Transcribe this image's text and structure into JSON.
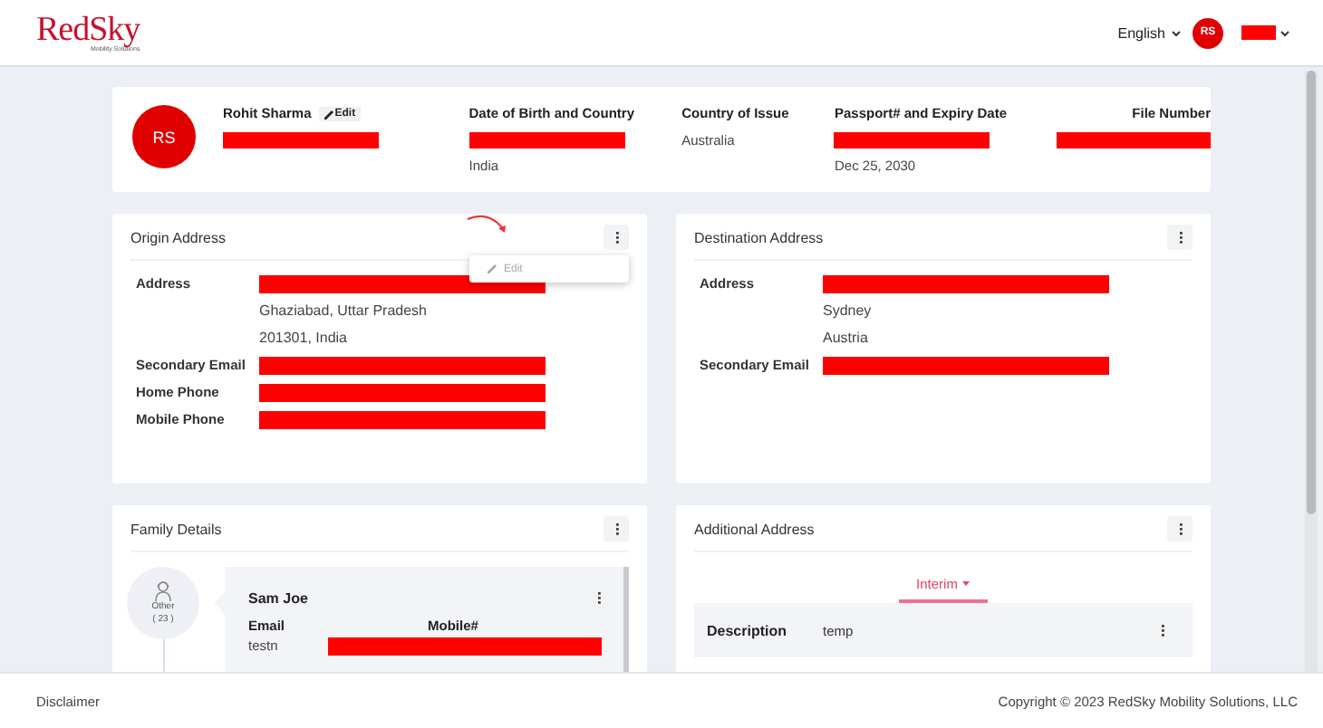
{
  "header": {
    "logo": "RedSky",
    "logo_tagline": "Mobility Solutions",
    "language": "English",
    "user_initials": "RS",
    "user_name": {
      "kind": "redacted"
    }
  },
  "profile": {
    "initials": "RS",
    "name": "Rohit Sharma",
    "edit_label": "Edit",
    "columns": [
      {
        "heading": "Date of Birth and Country",
        "lines": [
          {
            "kind": "redacted"
          },
          {
            "kind": "text",
            "text": "India"
          }
        ]
      },
      {
        "heading": "Country of Issue",
        "lines": [
          {
            "kind": "text",
            "text": "Australia"
          }
        ]
      },
      {
        "heading": "Passport# and Expiry Date",
        "lines": [
          {
            "kind": "redacted"
          },
          {
            "kind": "text",
            "text": "Dec 25, 2030"
          }
        ]
      },
      {
        "heading": "File Number",
        "lines": [
          {
            "kind": "redacted"
          }
        ]
      }
    ]
  },
  "origin_address": {
    "title": "Origin Address",
    "menu": {
      "open": true,
      "items": [
        {
          "label": "Edit",
          "disabled": true
        }
      ]
    },
    "rows": [
      {
        "label": "Address",
        "lines": [
          {
            "kind": "redacted"
          },
          {
            "kind": "text",
            "text": "Ghaziabad, Uttar Pradesh"
          },
          {
            "kind": "text",
            "text": "201301, India"
          }
        ]
      },
      {
        "label": "Secondary Email",
        "lines": [
          {
            "kind": "redacted"
          }
        ]
      },
      {
        "label": "Home Phone",
        "lines": [
          {
            "kind": "redacted"
          }
        ]
      },
      {
        "label": "Mobile Phone",
        "lines": [
          {
            "kind": "redacted"
          }
        ]
      }
    ]
  },
  "destination_address": {
    "title": "Destination Address",
    "rows": [
      {
        "label": "Address",
        "lines": [
          {
            "kind": "redacted"
          },
          {
            "kind": "text",
            "text": "Sydney"
          },
          {
            "kind": "text",
            "text": "Austria"
          }
        ]
      },
      {
        "label": "Secondary Email",
        "lines": [
          {
            "kind": "redacted"
          }
        ]
      }
    ]
  },
  "family_details": {
    "title": "Family Details",
    "member": {
      "relation": "Other",
      "age": "( 23 )",
      "name": "Sam Joe",
      "headings": [
        "Email",
        "Mobile#"
      ],
      "values": [
        {
          "kind": "text",
          "text": "testn"
        },
        {
          "kind": "redacted"
        }
      ]
    }
  },
  "additional_address": {
    "title": "Additional Address",
    "tabs": [
      {
        "label": "Interim",
        "selected": true
      }
    ],
    "rows": [
      {
        "label": "Description",
        "value": "temp"
      }
    ]
  },
  "footer": {
    "disclaimer": "Disclaimer",
    "copyright": "Copyright © 2023 RedSky Mobility Solutions, LLC"
  }
}
